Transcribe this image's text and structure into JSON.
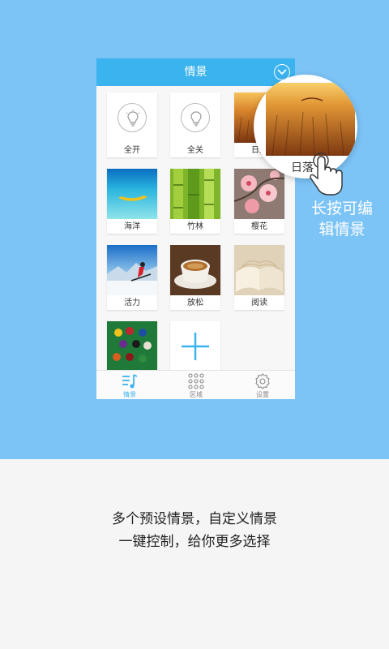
{
  "header": {
    "title": "情景"
  },
  "scenes": [
    {
      "label": "全开",
      "icon": "lightbulb-on-icon"
    },
    {
      "label": "全关",
      "icon": "lightbulb-off-icon"
    },
    {
      "label": "日落",
      "icon": "sunset-photo"
    },
    {
      "label": "海洋",
      "icon": "ocean-photo"
    },
    {
      "label": "竹林",
      "icon": "bamboo-photo"
    },
    {
      "label": "樱花",
      "icon": "cherry-blossom-photo"
    },
    {
      "label": "活力",
      "icon": "skiing-photo"
    },
    {
      "label": "放松",
      "icon": "coffee-photo"
    },
    {
      "label": "阅读",
      "icon": "book-photo"
    },
    {
      "label": "",
      "icon": "billiards-photo"
    },
    {
      "label": "",
      "icon": "add-icon"
    }
  ],
  "tabs": [
    {
      "label": "情景",
      "icon": "music-list-icon",
      "active": true
    },
    {
      "label": "区域",
      "icon": "grid-dots-icon",
      "active": false
    },
    {
      "label": "设置",
      "icon": "gear-icon",
      "active": false
    }
  ],
  "magnifier": {
    "label": "日落"
  },
  "hint": {
    "line1": "长按可编",
    "line2": "辑情景"
  },
  "caption": {
    "line1": "多个预设情景，自定义情景",
    "line2": "一键控制，给你更多选择"
  },
  "colors": {
    "background_blue": "#7cc3f6",
    "header_blue": "#3bb3ee",
    "active_tab": "#3bb3ee"
  }
}
